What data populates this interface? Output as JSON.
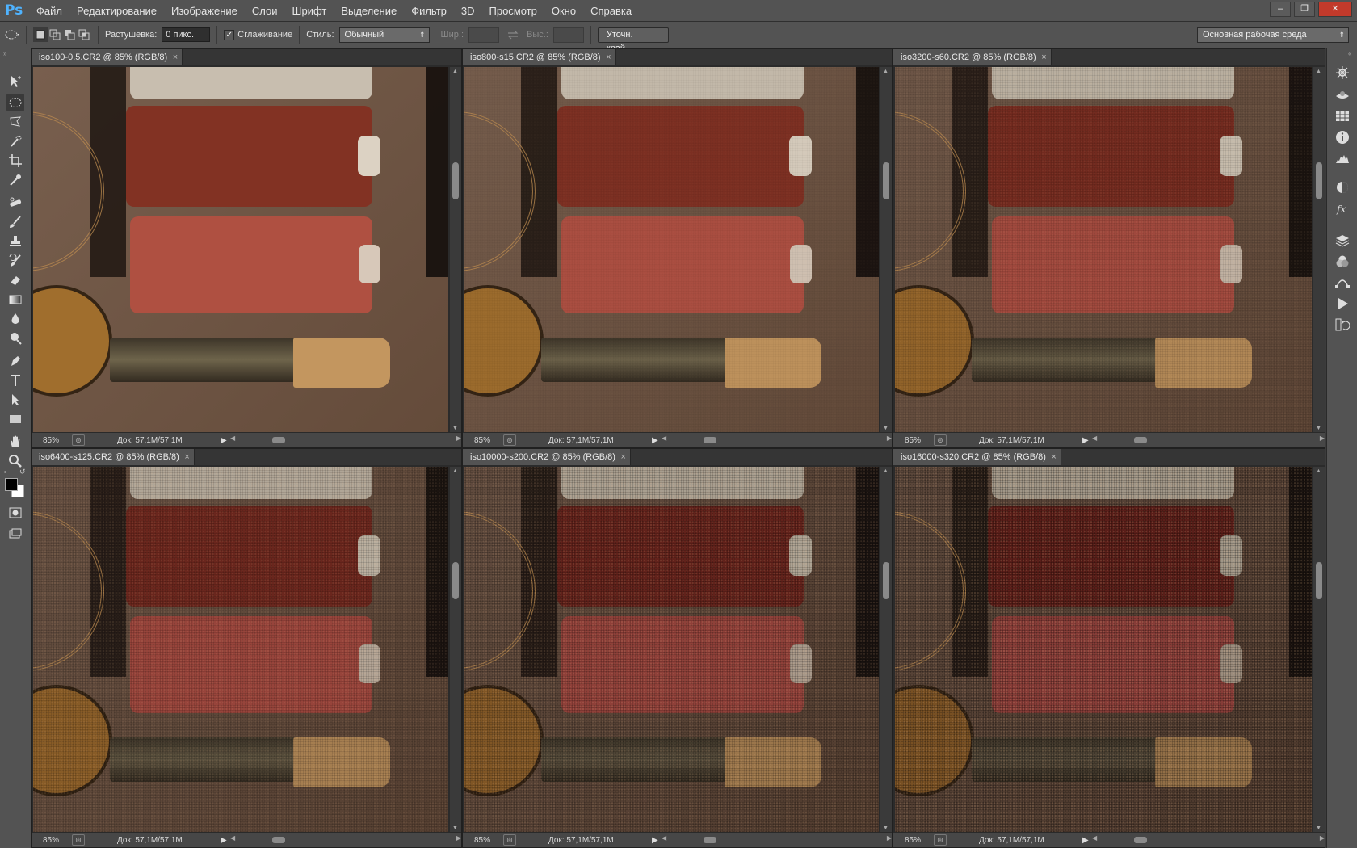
{
  "app": {
    "logo": "Ps",
    "menu": [
      "Файл",
      "Редактирование",
      "Изображение",
      "Слои",
      "Шрифт",
      "Выделение",
      "Фильтр",
      "3D",
      "Просмотр",
      "Окно",
      "Справка"
    ],
    "window_controls": [
      "–",
      "❐",
      "✕"
    ]
  },
  "options_bar": {
    "feather_label": "Растушевка:",
    "feather_value": "0 пикс.",
    "antialias_label": "Сглаживание",
    "antialias_checked": "✓",
    "style_label": "Стиль:",
    "style_value": "Обычный",
    "width_label": "Шир.:",
    "height_label": "Выс.:",
    "refine_button": "Уточн. край...",
    "workspace_value": "Основная рабочая среда"
  },
  "documents": [
    {
      "tab": "iso100-0.5.CR2 @ 85% (RGB/8)",
      "zoom": "85%",
      "doc_size": "Док: 57,1M/57,1M",
      "noise_level": 0.0
    },
    {
      "tab": "iso800-s15.CR2 @ 85% (RGB/8)",
      "zoom": "85%",
      "doc_size": "Док: 57,1M/57,1M",
      "noise_level": 0.15
    },
    {
      "tab": "iso3200-s60.CR2 @ 85% (RGB/8)",
      "zoom": "85%",
      "doc_size": "Док: 57,1M/57,1M",
      "noise_level": 0.4
    },
    {
      "tab": "iso6400-s125.CR2 @ 85% (RGB/8)",
      "zoom": "85%",
      "doc_size": "Док: 57,1M/57,1M",
      "noise_level": 0.6
    },
    {
      "tab": "iso10000-s200.CR2 @ 85% (RGB/8)",
      "zoom": "85%",
      "doc_size": "Док: 57,1M/57,1M",
      "noise_level": 0.8
    },
    {
      "tab": "iso16000-s320.CR2 @ 85% (RGB/8)",
      "zoom": "85%",
      "doc_size": "Док: 57,1M/57,1M",
      "noise_level": 1.0
    }
  ],
  "icons": {
    "tools": [
      "move-icon",
      "ellipse-marquee-icon",
      "lasso-icon",
      "quick-selection-icon",
      "crop-icon",
      "eyedropper-icon",
      "healing-brush-icon",
      "brush-icon",
      "clone-stamp-icon",
      "history-brush-icon",
      "eraser-icon",
      "gradient-icon",
      "blur-icon",
      "dodge-icon",
      "pen-icon",
      "type-icon",
      "path-selection-icon",
      "rectangle-icon",
      "hand-icon",
      "zoom-icon"
    ],
    "dock": [
      "navigator-icon",
      "3d-icon",
      "swatches-icon",
      "info-icon",
      "histogram-icon",
      "adjustments-icon",
      "styles-icon",
      "layers-icon",
      "channels-icon",
      "paths-icon",
      "actions-icon",
      "history-icon"
    ]
  },
  "colors": {
    "ui_bg": "#535353",
    "foreground_color": "#000000",
    "background_color": "#ffffff"
  }
}
